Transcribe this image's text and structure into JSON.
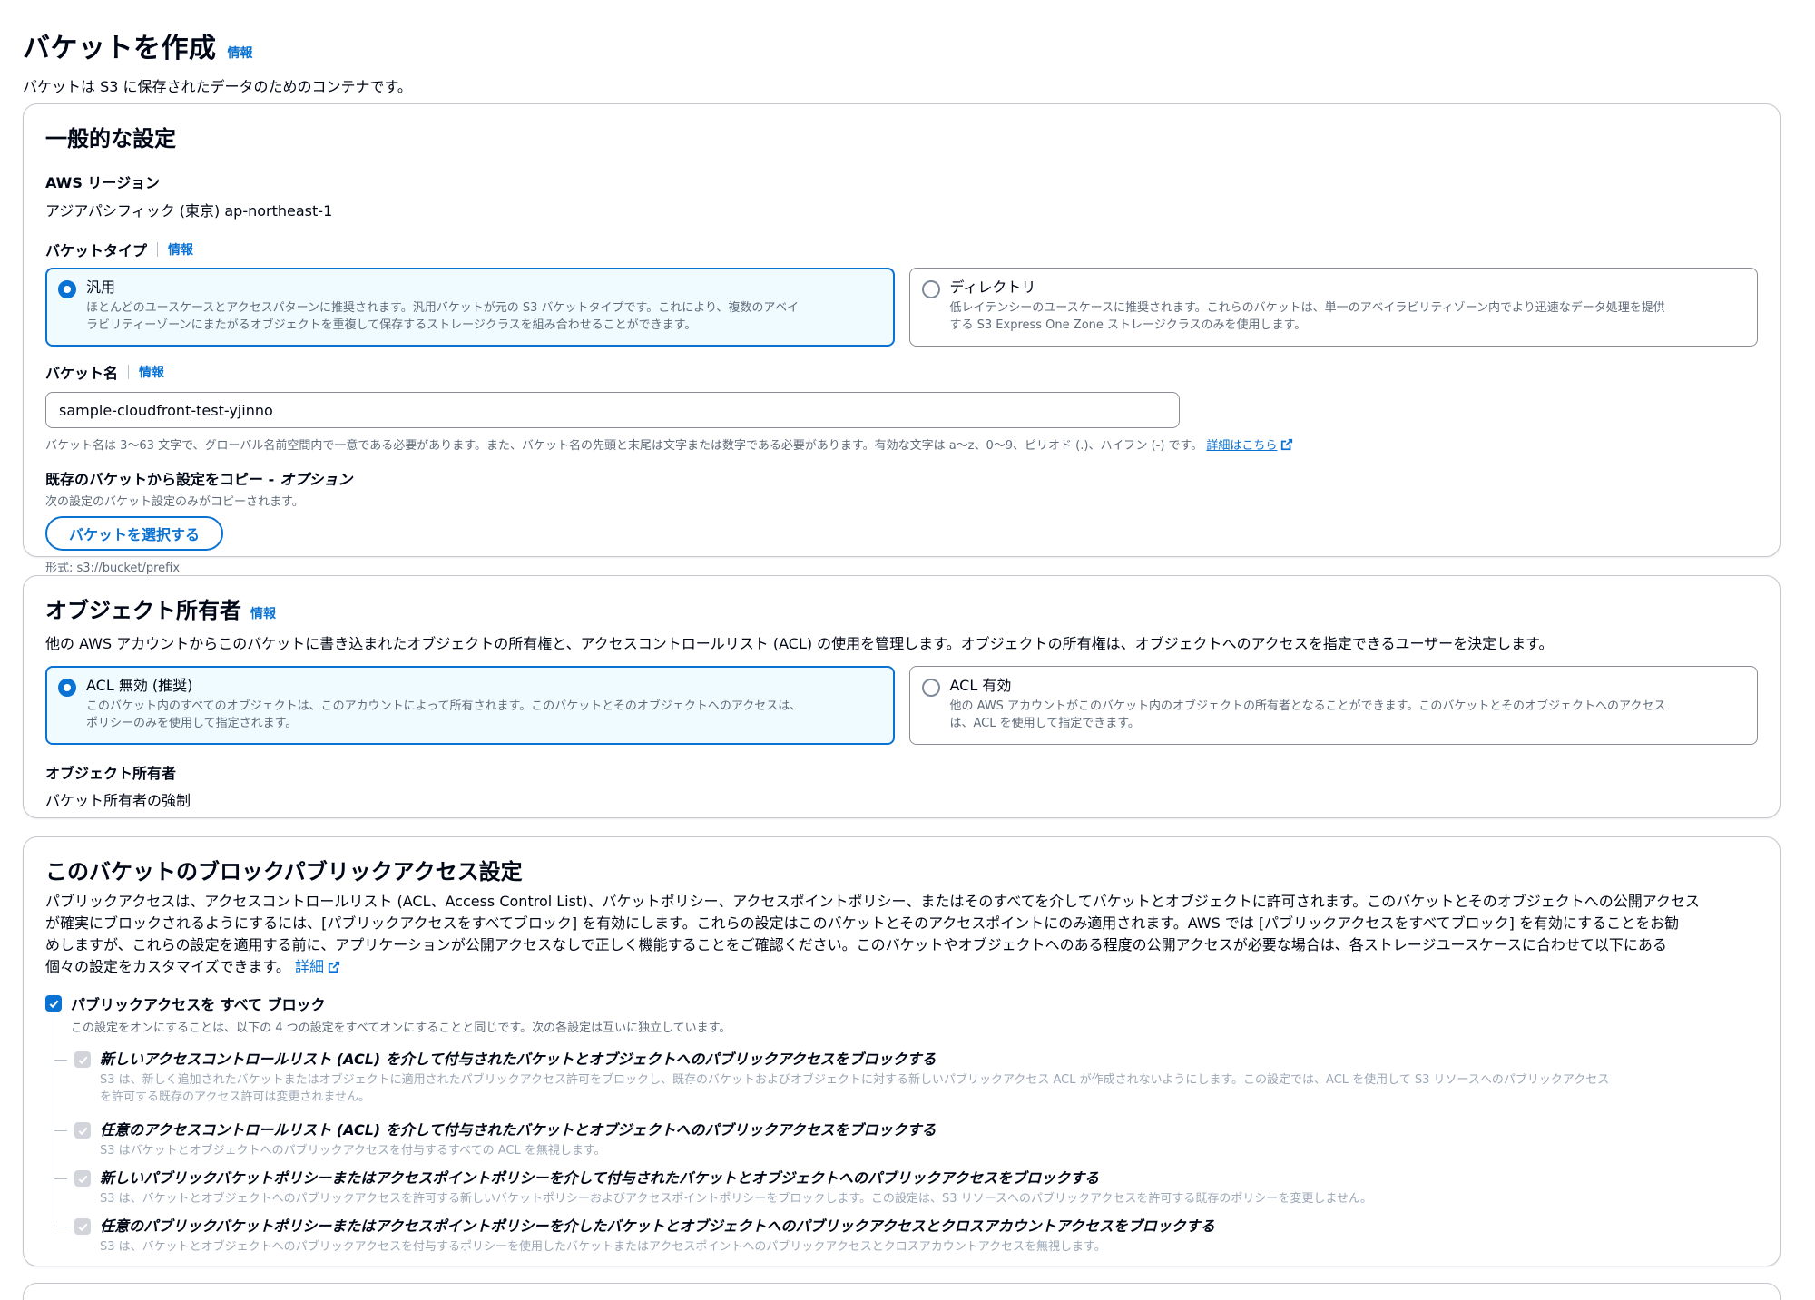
{
  "header": {
    "title": "バケットを作成",
    "info": "情報",
    "description": "バケットは S3 に保存されたデータのためのコンテナです。"
  },
  "general": {
    "title": "一般的な設定",
    "region_label": "AWS リージョン",
    "region_value": "アジアパシフィック (東京) ap-northeast-1",
    "bucket_type_label": "バケットタイプ",
    "info": "情報",
    "types": [
      {
        "title": "汎用",
        "desc1": "ほとんどのユースケースとアクセスパターンに推奨されます。汎用バケットが元の S3 バケットタイプです。これにより、複数のアベイ",
        "desc2": "ラビリティーゾーンにまたがるオブジェクトを重複して保存するストレージクラスを組み合わせることができます。",
        "selected": true
      },
      {
        "title": "ディレクトリ",
        "desc1": "低レイテンシーのユースケースに推奨されます。これらのバケットは、単一のアベイラビリティゾーン内でより迅速なデータ処理を提供",
        "desc2": "する S3 Express One Zone ストレージクラスのみを使用します。",
        "selected": false
      }
    ],
    "bucket_name_label": "バケット名",
    "bucket_name_value": "sample-cloudfront-test-yjinno",
    "bucket_name_hint": "バケット名は 3～63 文字で、グローバル名前空間内で一意である必要があります。また、バケット名の先頭と末尾は文字または数字である必要があります。有効な文字は a～z、0～9、ピリオド (.)、ハイフン (-) です。",
    "bucket_name_link": "詳細はこちら",
    "copy_label": "既存のバケットから設定をコピー - ",
    "copy_label_optional": "オプション",
    "copy_hint": "次の設定のバケット設定のみがコピーされます。",
    "copy_button": "バケットを選択する",
    "copy_format": "形式: s3://bucket/prefix"
  },
  "ownership": {
    "title": "オブジェクト所有者",
    "info": "情報",
    "description": "他の AWS アカウントからこのバケットに書き込まれたオブジェクトの所有権と、アクセスコントロールリスト (ACL) の使用を管理します。オブジェクトの所有権は、オブジェクトへのアクセスを指定できるユーザーを決定します。",
    "options": [
      {
        "title": "ACL 無効 (推奨)",
        "desc1": "このバケット内のすべてのオブジェクトは、このアカウントによって所有されます。このバケットとそのオブジェクトへのアクセスは、",
        "desc2": "ポリシーのみを使用して指定されます。",
        "selected": true
      },
      {
        "title": "ACL 有効",
        "desc1": "他の AWS アカウントがこのバケット内のオブジェクトの所有者となることができます。このバケットとそのオブジェクトへのアクセス",
        "desc2": "は、ACL を使用して指定できます。",
        "selected": false
      }
    ],
    "owner_label": "オブジェクト所有者",
    "owner_value": "バケット所有者の強制"
  },
  "public_access": {
    "title": "このバケットのブロックパブリックアクセス設定",
    "desc_lines": [
      "パブリックアクセスは、アクセスコントロールリスト (ACL、Access Control List)、バケットポリシー、アクセスポイントポリシー、またはそのすべてを介してバケットとオブジェクトに許可されます。このバケットとそのオブジェクトへの公開アクセス",
      "が確実にブロックされるようにするには、[パブリックアクセスをすべてブロック] を有効にします。これらの設定はこのバケットとそのアクセスポイントにのみ適用されます。AWS では [パブリックアクセスをすべてブロック] を有効にすることをお勧",
      "めしますが、これらの設定を適用する前に、アプリケーションが公開アクセスなしで正しく機能することをご確認ください。このバケットやオブジェクトへのある程度の公開アクセスが必要な場合は、各ストレージユースケースに合わせて以下にある",
      "個々の設定をカスタマイズできます。"
    ],
    "desc_link": "詳細",
    "block_all_label": "パブリックアクセスを すべて ブロック",
    "block_all_hint": "この設定をオンにすることは、以下の 4 つの設定をすべてオンにすることと同じです。次の各設定は互いに独立しています。",
    "items": [
      {
        "title": "新しいアクセスコントロールリスト (ACL) を介して付与されたバケットとオブジェクトへのパブリックアクセスをブロックする",
        "desc1": "S3 は、新しく追加されたバケットまたはオブジェクトに適用されたパブリックアクセス許可をブロックし、既存のバケットおよびオブジェクトに対する新しいパブリックアクセス ACL が作成されないようにします。この設定では、ACL を使用して S3 リソースへのパブリックアクセス",
        "desc2": "を許可する既存のアクセス許可は変更されません。"
      },
      {
        "title": "任意のアクセスコントロールリスト (ACL) を介して付与されたバケットとオブジェクトへのパブリックアクセスをブロックする",
        "desc1": "S3 はバケットとオブジェクトへのパブリックアクセスを付与するすべての ACL を無視します。",
        "desc2": ""
      },
      {
        "title": "新しいパブリックバケットポリシーまたはアクセスポイントポリシーを介して付与されたバケットとオブジェクトへのパブリックアクセスをブロックする",
        "desc1": "S3 は、バケットとオブジェクトへのパブリックアクセスを許可する新しいバケットポリシーおよびアクセスポイントポリシーをブロックします。この設定は、S3 リソースへのパブリックアクセスを許可する既存のポリシーを変更しません。",
        "desc2": ""
      },
      {
        "title": "任意のパブリックバケットポリシーまたはアクセスポイントポリシーを介したバケットとオブジェクトへのパブリックアクセスとクロスアカウントアクセスをブロックする",
        "desc1": "S3 は、バケットとオブジェクトへのパブリックアクセスを付与するポリシーを使用したバケットまたはアクセスポイントへのパブリックアクセスとクロスアカウントアクセスを無視します。",
        "desc2": ""
      }
    ]
  },
  "colors": {
    "accent": "#0972d3",
    "selected_bg": "#f0fbff",
    "border": "#c6c6cd",
    "muted_text": "#5f6b7a",
    "disabled_text": "#9ba7b6"
  }
}
